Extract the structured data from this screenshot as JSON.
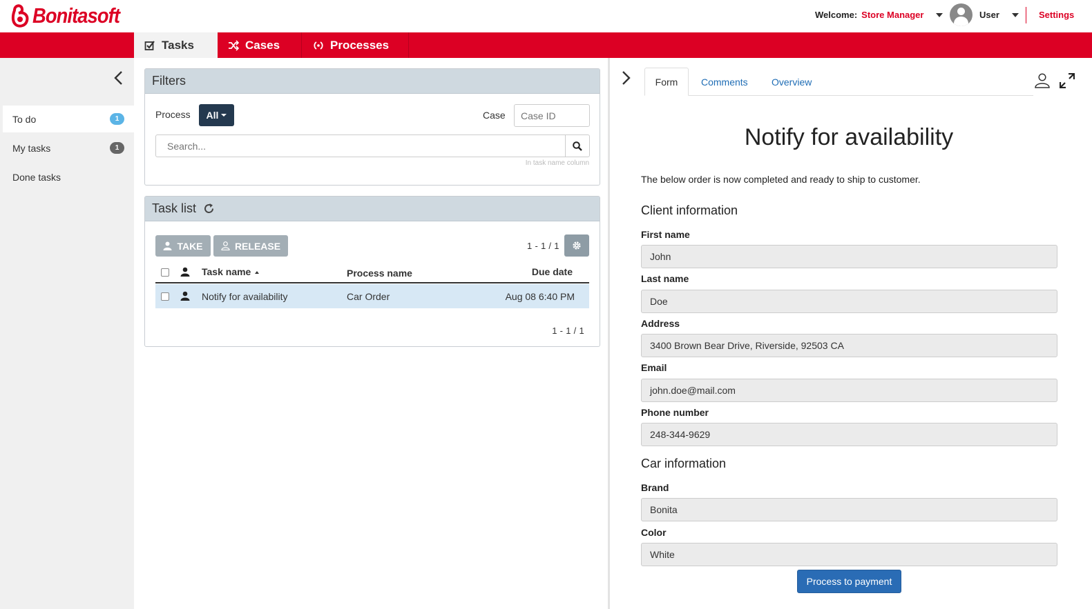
{
  "header": {
    "brand": "Bonitasoft",
    "welcome_label": "Welcome:",
    "profile_name": "Store Manager",
    "user_name": "User",
    "settings_label": "Settings"
  },
  "nav": {
    "tabs": [
      {
        "label": "Tasks",
        "icon": "check-square-icon"
      },
      {
        "label": "Cases",
        "icon": "shuffle-icon"
      },
      {
        "label": "Processes",
        "icon": "process-icon"
      }
    ]
  },
  "sidebar": {
    "items": [
      {
        "label": "To do",
        "count": "1"
      },
      {
        "label": "My tasks",
        "count": "1"
      },
      {
        "label": "Done tasks"
      }
    ]
  },
  "filters": {
    "title": "Filters",
    "process_label": "Process",
    "process_value": "All",
    "case_label": "Case",
    "case_placeholder": "Case ID",
    "search_placeholder": "Search...",
    "search_hint": "In task name column"
  },
  "tasklist": {
    "title": "Task list",
    "take_label": "TAKE",
    "release_label": "RELEASE",
    "pager": "1 - 1 / 1",
    "columns": {
      "task": "Task name",
      "process": "Process name",
      "due": "Due date"
    },
    "rows": [
      {
        "task": "Notify for availability",
        "process": "Car Order",
        "due": "Aug 08 6:40 PM"
      }
    ]
  },
  "form_pane": {
    "tabs": [
      "Form",
      "Comments",
      "Overview"
    ],
    "title": "Notify for availability",
    "intro": "The below order is now completed and ready to ship to customer.",
    "client_section": "Client information",
    "car_section": "Car information",
    "fields": {
      "first_name": {
        "label": "First name",
        "value": "John"
      },
      "last_name": {
        "label": "Last name",
        "value": "Doe"
      },
      "address": {
        "label": "Address",
        "value": "3400 Brown Bear Drive, Riverside, 92503 CA"
      },
      "email": {
        "label": "Email",
        "value": "john.doe@mail.com"
      },
      "phone": {
        "label": "Phone number",
        "value": "248-344-9629"
      },
      "brand": {
        "label": "Brand",
        "value": "Bonita"
      },
      "color": {
        "label": "Color",
        "value": "White"
      }
    },
    "submit_label": "Process to payment"
  },
  "colors": {
    "brand_red": "#dc0024",
    "nav_active_bg": "#f2f2f2",
    "badge_blue": "#5bb4e6",
    "primary_button": "#2a6cb5",
    "selected_row": "#d7e8f5"
  }
}
